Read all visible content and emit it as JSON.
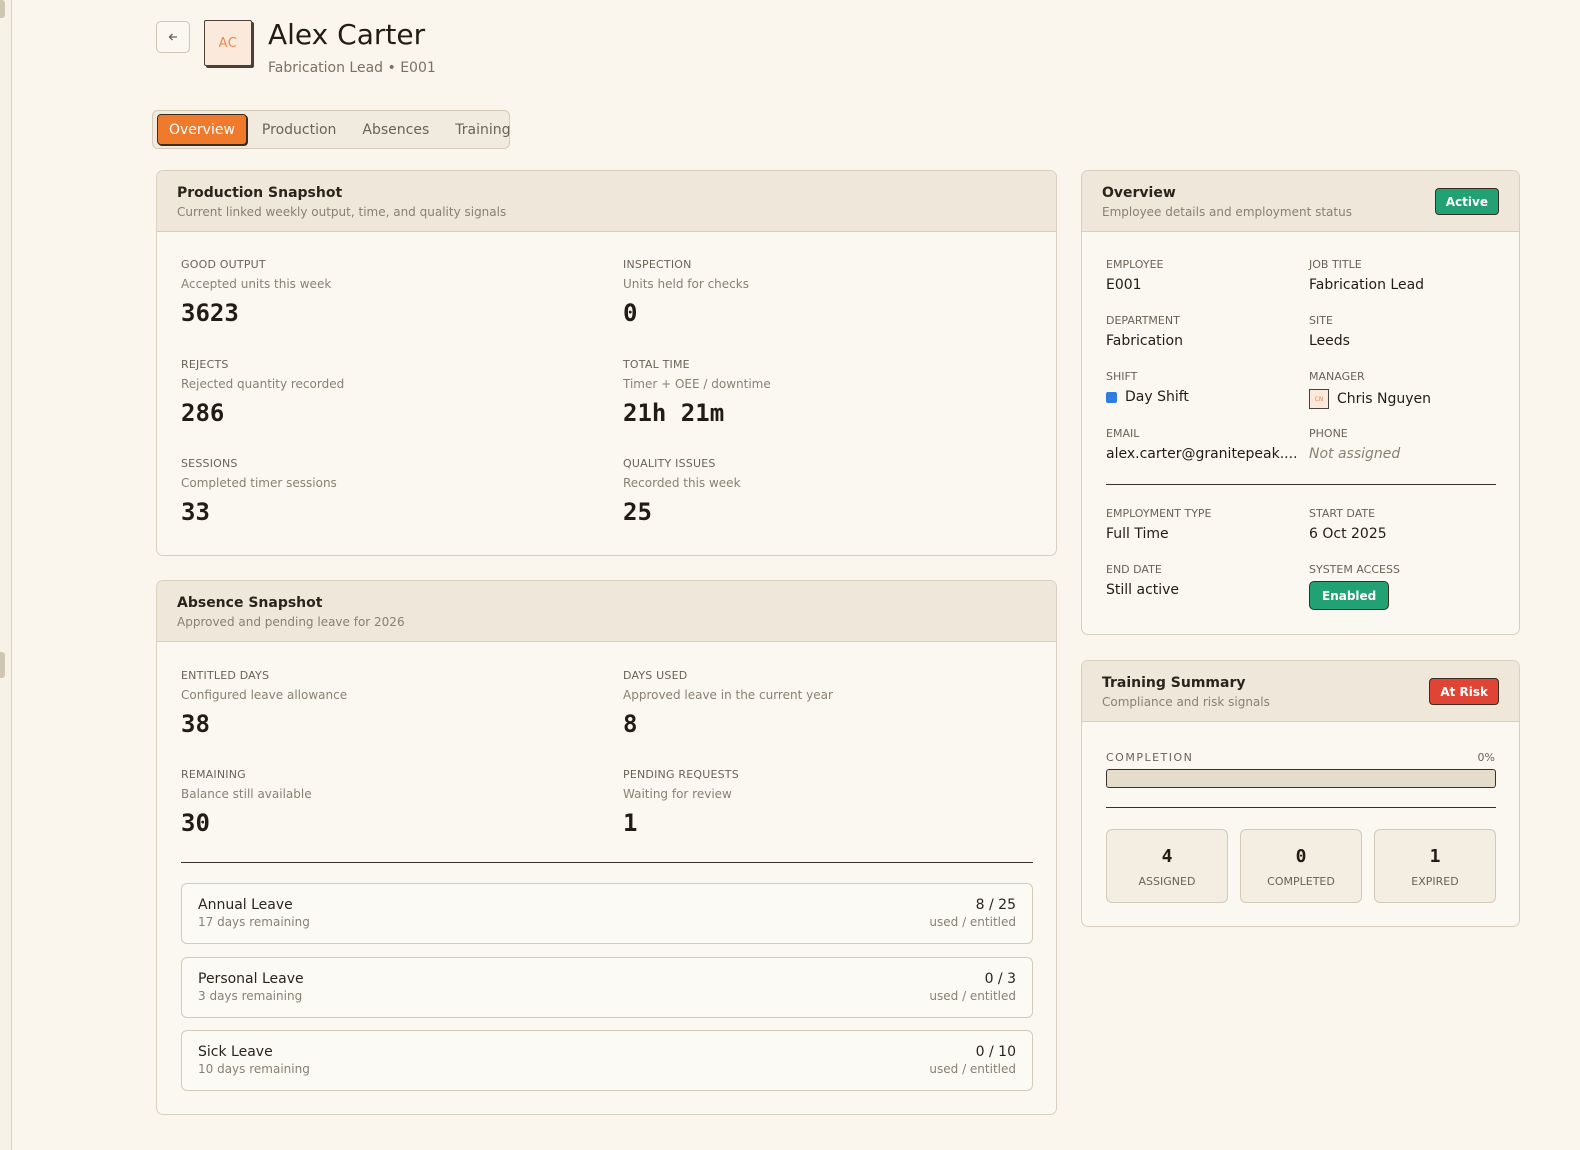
{
  "header": {
    "back_icon": "arrow-left-icon",
    "avatar_initials": "AC",
    "name": "Alex Carter",
    "subtitle": "Fabrication Lead • E001"
  },
  "tabs": [
    {
      "label": "Overview",
      "active": true
    },
    {
      "label": "Production",
      "active": false
    },
    {
      "label": "Absences",
      "active": false
    },
    {
      "label": "Training",
      "active": false
    }
  ],
  "production": {
    "title": "Production Snapshot",
    "subtitle": "Current linked weekly output, time, and quality signals",
    "metrics": [
      {
        "label": "Good Output",
        "desc": "Accepted units this week",
        "value": "3623"
      },
      {
        "label": "Inspection",
        "desc": "Units held for checks",
        "value": "0"
      },
      {
        "label": "Rejects",
        "desc": "Rejected quantity recorded",
        "value": "286"
      },
      {
        "label": "Total Time",
        "desc": "Timer + OEE / downtime",
        "value": "21h 21m"
      },
      {
        "label": "Sessions",
        "desc": "Completed timer sessions",
        "value": "33"
      },
      {
        "label": "Quality Issues",
        "desc": "Recorded this week",
        "value": "25"
      }
    ]
  },
  "absence": {
    "title": "Absence Snapshot",
    "subtitle": "Approved and pending leave for 2026",
    "metrics": [
      {
        "label": "Entitled Days",
        "desc": "Configured leave allowance",
        "value": "38"
      },
      {
        "label": "Days Used",
        "desc": "Approved leave in the current year",
        "value": "8"
      },
      {
        "label": "Remaining",
        "desc": "Balance still available",
        "value": "30"
      },
      {
        "label": "Pending Requests",
        "desc": "Waiting for review",
        "value": "1"
      }
    ],
    "leaves": [
      {
        "name": "Annual Leave",
        "remaining": "17 days remaining",
        "fraction": "8 / 25",
        "unit": "used / entitled"
      },
      {
        "name": "Personal Leave",
        "remaining": "3 days remaining",
        "fraction": "0 / 3",
        "unit": "used / entitled"
      },
      {
        "name": "Sick Leave",
        "remaining": "10 days remaining",
        "fraction": "0 / 10",
        "unit": "used / entitled"
      }
    ]
  },
  "overview": {
    "title": "Overview",
    "subtitle": "Employee details and employment status",
    "status_badge": "Active",
    "status_color": "#22a174",
    "fields": {
      "employee": {
        "label": "Employee",
        "value": "E001"
      },
      "job_title": {
        "label": "Job Title",
        "value": "Fabrication Lead"
      },
      "department": {
        "label": "Department",
        "value": "Fabrication"
      },
      "site": {
        "label": "Site",
        "value": "Leeds"
      },
      "shift": {
        "label": "Shift",
        "value": "Day Shift",
        "color": "#2f7de1"
      },
      "manager": {
        "label": "Manager",
        "value": "Chris Nguyen",
        "initials": "CN"
      },
      "email": {
        "label": "Email",
        "value": "alex.carter@granitepeak...."
      },
      "phone": {
        "label": "Phone",
        "value": "Not assigned"
      },
      "employment_type": {
        "label": "Employment Type",
        "value": "Full Time"
      },
      "start_date": {
        "label": "Start Date",
        "value": "6 Oct 2025"
      },
      "end_date": {
        "label": "End Date",
        "value": "Still active"
      },
      "system_access": {
        "label": "System Access",
        "value": "Enabled"
      }
    }
  },
  "training": {
    "title": "Training Summary",
    "subtitle": "Compliance and risk signals",
    "risk_badge": "At Risk",
    "risk_color": "#e04434",
    "completion_label": "COMPLETION",
    "completion_pct": "0%",
    "completion_fraction": 0,
    "stats": [
      {
        "num": "4",
        "label": "ASSIGNED"
      },
      {
        "num": "0",
        "label": "COMPLETED"
      },
      {
        "num": "1",
        "label": "EXPIRED"
      }
    ]
  }
}
